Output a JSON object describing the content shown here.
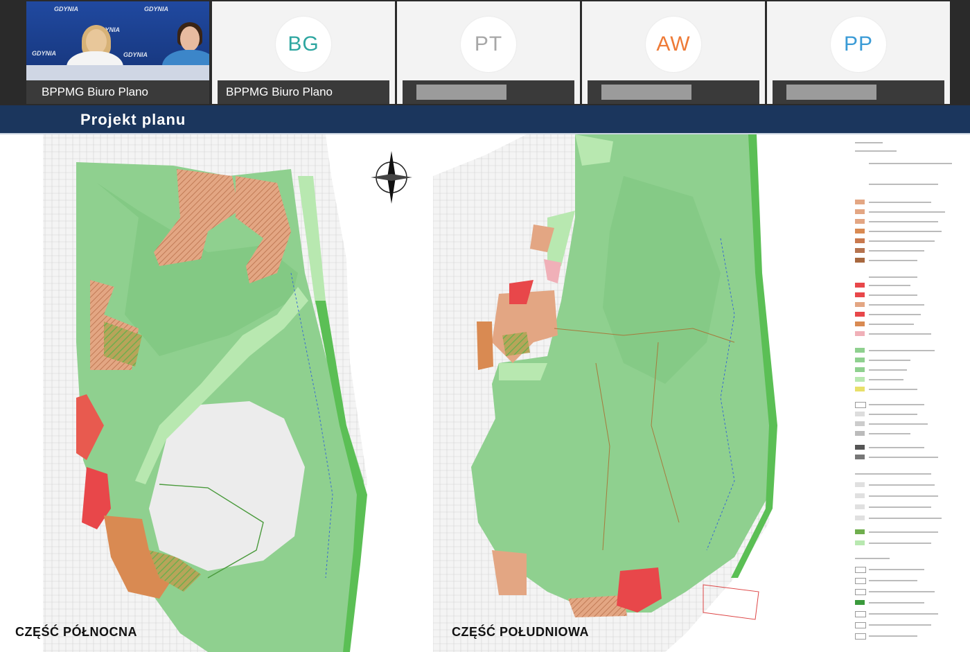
{
  "participants": [
    {
      "type": "video",
      "name": "BPPMG Biuro Plano",
      "video_brand": "GDYNIA"
    },
    {
      "type": "avatar",
      "initials": "BG",
      "initials_color": "#2ea6a0",
      "name": "BPPMG Biuro Plano"
    },
    {
      "type": "avatar",
      "initials": "PT",
      "initials_color": "#a7a7a7",
      "name": ""
    },
    {
      "type": "avatar",
      "initials": "AW",
      "initials_color": "#ee7a36",
      "name": ""
    },
    {
      "type": "avatar",
      "initials": "PP",
      "initials_color": "#3a9bd6",
      "name": ""
    }
  ],
  "banner": {
    "title": "Projekt  planu"
  },
  "maps": {
    "north_caption": "CZĘŚĆ PÓŁNOCNA",
    "south_caption": "CZĘŚĆ POŁUDNIOWA"
  },
  "colors": {
    "forest": "#8fd08f",
    "forest_dark": "#7bc47d",
    "meadow": "#b8e8b0",
    "residential": "#e3a683",
    "services": "#e8474a",
    "pink": "#f0b0b8",
    "quarry": "#ececec",
    "banner": "#1b365d"
  }
}
